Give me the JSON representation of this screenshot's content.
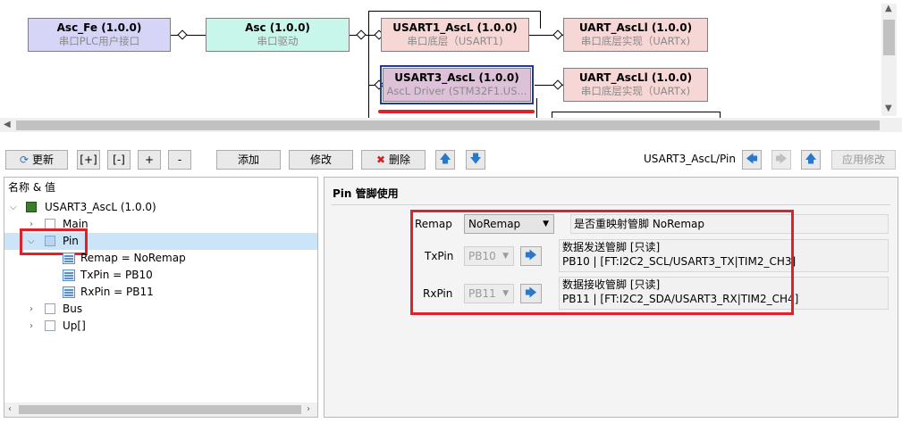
{
  "diagram": {
    "nodes": [
      {
        "title": "Asc_Fe (1.0.0)",
        "sub": "串口PLC用户接口"
      },
      {
        "title": "Asc (1.0.0)",
        "sub": "串口驱动"
      },
      {
        "title": "USART1_AscL (1.0.0)",
        "sub": "串口底层（USART1)"
      },
      {
        "title": "UART_AscLl (1.0.0)",
        "sub": "串口底层实现（UARTx)"
      },
      {
        "title": "USART3_AscL (1.0.0)",
        "sub": "AscL Driver (STM32F1.US..."
      },
      {
        "title": "UART_AscLl (1.0.0)",
        "sub": "串口底层实现（UARTx)"
      }
    ]
  },
  "toolbar": {
    "refresh": "更新",
    "expand": "[+]",
    "collapse": "[-]",
    "plus": "+",
    "minus": "-",
    "add": "添加",
    "modify": "修改",
    "delete": "删除",
    "path": "USART3_AscL/Pin",
    "apply": "应用修改"
  },
  "tree": {
    "header": "名称 & 值",
    "root": "USART3_AscL (1.0.0)",
    "items": [
      "Main",
      "Pin",
      "Remap = NoRemap",
      "TxPin = PB10",
      "RxPin = PB11",
      "Bus",
      "Up[]"
    ]
  },
  "detail": {
    "title": "Pin 管脚使用",
    "remap": {
      "label": "Remap",
      "value": "NoRemap",
      "desc": "是否重映射管脚 NoRemap"
    },
    "txpin": {
      "label": "TxPin",
      "value": "PB10",
      "desc1": "数据发送管脚 [只读]",
      "desc2": "PB10 | [FT:I2C2_SCL/USART3_TX|TIM2_CH3]"
    },
    "rxpin": {
      "label": "RxPin",
      "value": "PB11",
      "desc1": "数据接收管脚 [只读]",
      "desc2": "PB11 | [FT:I2C2_SDA/USART3_RX|TIM2_CH4]"
    }
  },
  "colors": {
    "highlight": "#e0202a",
    "selection": "#cce4f7",
    "accent": "#1f3aa8"
  }
}
